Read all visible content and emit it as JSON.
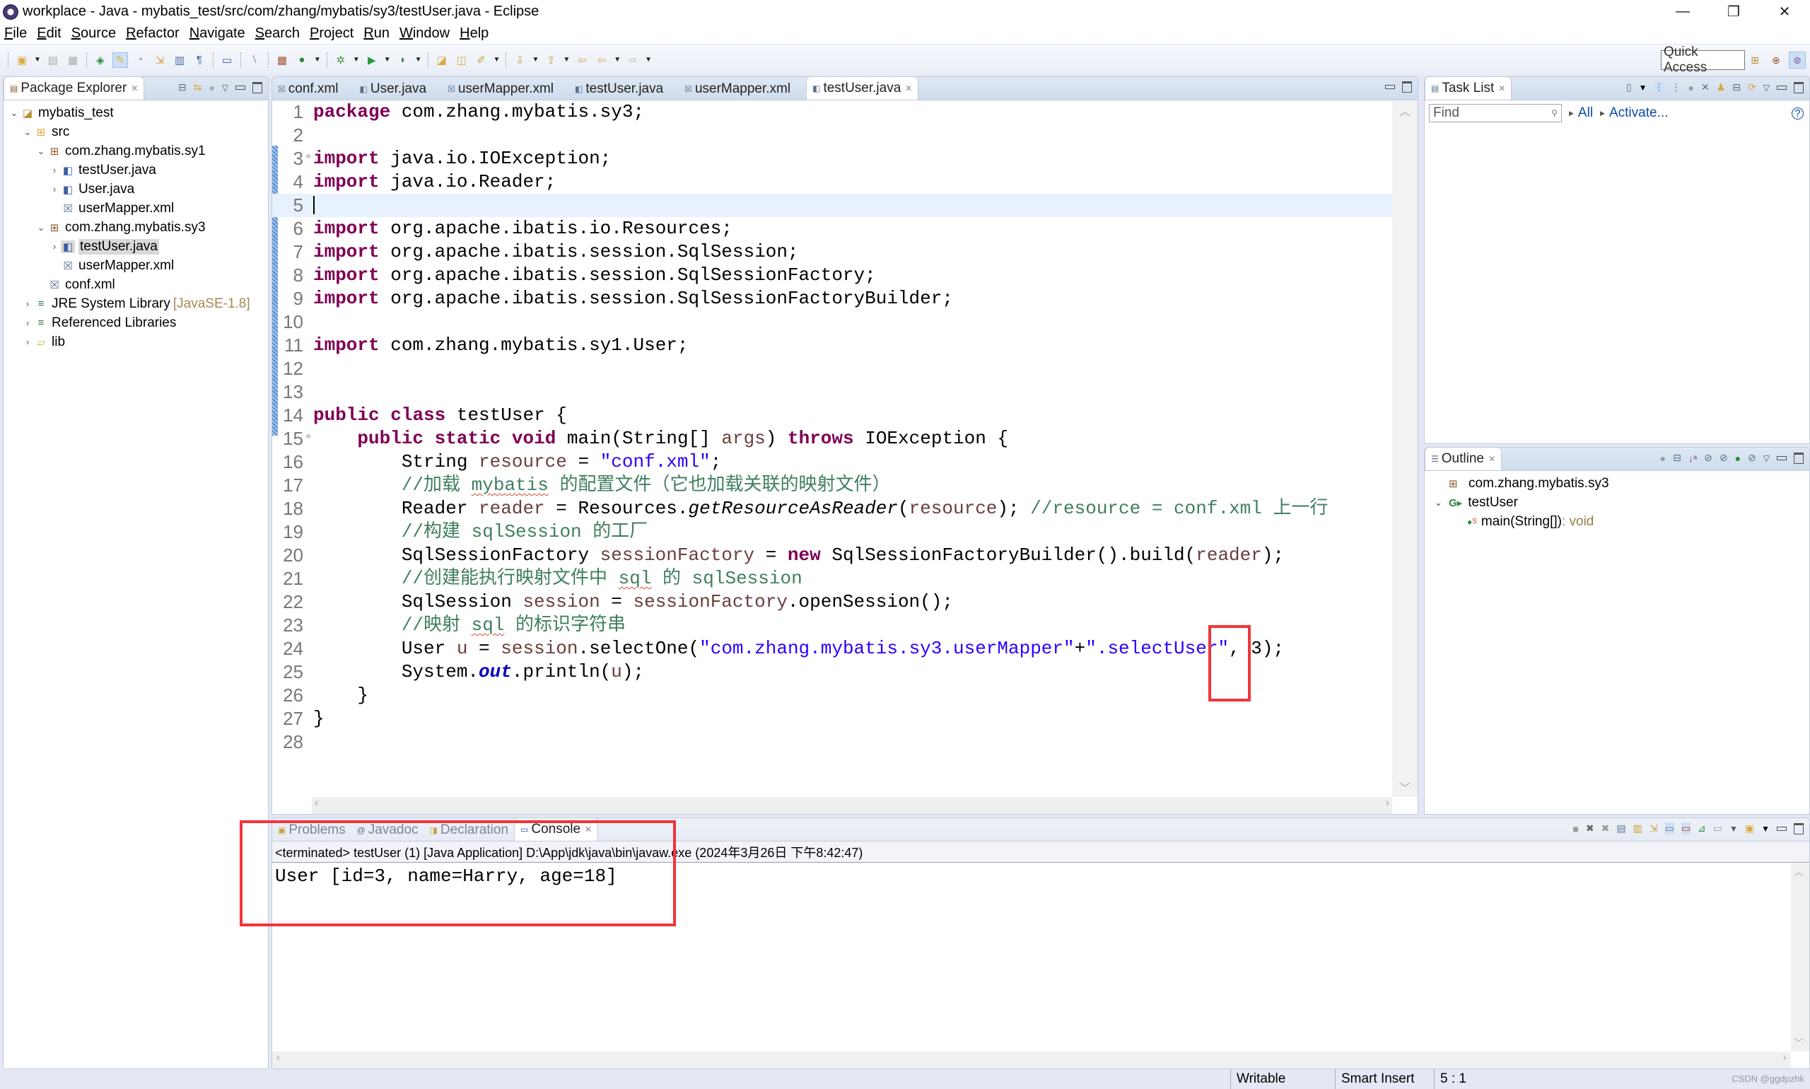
{
  "window": {
    "title": "workplace - Java - mybatis_test/src/com/zhang/mybatis/sy3/testUser.java - Eclipse",
    "controls": [
      "—",
      "❐",
      "✕"
    ]
  },
  "menu": [
    "File",
    "Edit",
    "Source",
    "Refactor",
    "Navigate",
    "Search",
    "Project",
    "Run",
    "Window",
    "Help"
  ],
  "toolbar": {
    "quick_access": "Quick Access"
  },
  "package_explorer": {
    "title": "Package Explorer",
    "tree": [
      {
        "label": "mybatis_test",
        "icon": "project-icon",
        "expanded": true
      },
      {
        "label": "src",
        "icon": "source-folder-icon",
        "expanded": true
      },
      {
        "label": "com.zhang.mybatis.sy1",
        "icon": "package-icon",
        "expanded": true
      },
      {
        "label": "testUser.java",
        "icon": "java-file-icon"
      },
      {
        "label": "User.java",
        "icon": "java-file-icon"
      },
      {
        "label": "userMapper.xml",
        "icon": "xml-file-icon"
      },
      {
        "label": "com.zhang.mybatis.sy3",
        "icon": "package-icon",
        "expanded": true
      },
      {
        "label": "testUser.java",
        "icon": "java-file-icon",
        "selected": true
      },
      {
        "label": "userMapper.xml",
        "icon": "xml-file-icon"
      },
      {
        "label": "conf.xml",
        "icon": "xml-file-icon"
      },
      {
        "label": "JRE System Library",
        "decoration": "[JavaSE-1.8]",
        "icon": "library-icon"
      },
      {
        "label": "Referenced Libraries",
        "icon": "library-icon"
      },
      {
        "label": "lib",
        "icon": "folder-icon"
      }
    ]
  },
  "editor": {
    "tabs": [
      {
        "label": "conf.xml",
        "icon": "xml-file-icon"
      },
      {
        "label": "User.java",
        "icon": "java-file-icon"
      },
      {
        "label": "userMapper.xml",
        "icon": "xml-file-icon"
      },
      {
        "label": "testUser.java",
        "icon": "java-file-icon"
      },
      {
        "label": "userMapper.xml",
        "icon": "xml-file-icon"
      },
      {
        "label": "testUser.java",
        "icon": "java-file-icon",
        "active": true
      }
    ],
    "lines": [
      "package com.zhang.mybatis.sy3;",
      "",
      "import java.io.IOException;",
      "import java.io.Reader;",
      "",
      "import org.apache.ibatis.io.Resources;",
      "import org.apache.ibatis.session.SqlSession;",
      "import org.apache.ibatis.session.SqlSessionFactory;",
      "import org.apache.ibatis.session.SqlSessionFactoryBuilder;",
      "",
      "import com.zhang.mybatis.sy1.User;",
      "",
      "",
      "public class testUser {",
      "    public static void main(String[] args) throws IOException {",
      "        String resource = \"conf.xml\";",
      "        //加载 mybatis 的配置文件（它也加载关联的映射文件）",
      "        Reader reader = Resources.getResourceAsReader(resource); //resource = conf.xml 上一行",
      "        //构建 sqlSession 的工厂",
      "        SqlSessionFactory sessionFactory = new SqlSessionFactoryBuilder().build(reader);",
      "        //创建能执行映射文件中 sql 的 sqlSession",
      "        SqlSession session = sessionFactory.openSession();",
      "        //映射 sql 的标识字符串",
      "        User u = session.selectOne(\"com.zhang.mybatis.sy3.userMapper\"+\".selectUser\", 3);",
      "        System.out.println(u);",
      "    }",
      "}",
      ""
    ],
    "current_line": 5
  },
  "task_list": {
    "title": "Task List",
    "find_placeholder": "Find",
    "all_link": "All",
    "activate_link": "Activate..."
  },
  "outline": {
    "title": "Outline",
    "items": [
      {
        "label": "com.zhang.mybatis.sy3",
        "icon": "package-icon"
      },
      {
        "label": "testUser",
        "icon": "class-icon",
        "expanded": true
      },
      {
        "label": "main(String[])",
        "ret": " : void",
        "icon": "method-icon"
      }
    ]
  },
  "console": {
    "tabs": [
      {
        "label": "Problems",
        "icon": "problems-icon"
      },
      {
        "label": "Javadoc",
        "icon": "javadoc-icon"
      },
      {
        "label": "Declaration",
        "icon": "declaration-icon"
      },
      {
        "label": "Console",
        "icon": "console-icon",
        "active": true
      }
    ],
    "info": "<terminated> testUser (1) [Java Application] D:\\App\\jdk\\java\\bin\\javaw.exe (2024年3月26日 下午8:42:47)",
    "output": "User [id=3, name=Harry, age=18]"
  },
  "status": {
    "writable": "Writable",
    "insert_mode": "Smart Insert",
    "position": "5 : 1",
    "watermark": "CSDN @ggdpzhk"
  },
  "colors": {
    "keyword": "#7f0055",
    "string": "#2a00ff",
    "comment": "#3f7f5f",
    "variable": "#6a3e3e",
    "field": "#0000c0",
    "annotation_box": "#f2343a"
  }
}
